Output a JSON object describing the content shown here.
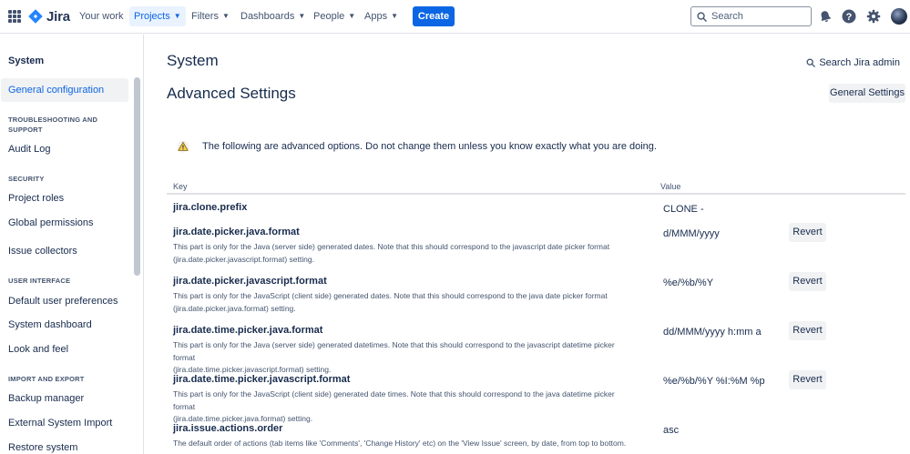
{
  "brand": {
    "name": "Jira"
  },
  "nav": {
    "your_work": "Your work",
    "projects": "Projects",
    "filters": "Filters",
    "dashboards": "Dashboards",
    "people": "People",
    "apps": "Apps",
    "create": "Create"
  },
  "search": {
    "placeholder": "Search"
  },
  "icons": {
    "apps": "app-switcher-icon",
    "notifications": "bell-icon",
    "help": "help-icon",
    "settings": "gear-icon",
    "search": "search-icon",
    "warning": "warning-icon"
  },
  "colors": {
    "accent": "#0c66e4",
    "warning": "#f5cd47",
    "selected_bg": "#e9f2ff"
  },
  "sidebar": {
    "title": "System",
    "general_configuration": "General configuration",
    "troubleshooting_heading": "TROUBLESHOOTING AND SUPPORT",
    "audit_log": "Audit Log",
    "security_heading": "SECURITY",
    "project_roles": "Project roles",
    "global_permissions": "Global permissions",
    "issue_collectors": "Issue collectors",
    "user_interface_heading": "USER INTERFACE",
    "default_user_preferences": "Default user preferences",
    "system_dashboard": "System dashboard",
    "look_and_feel": "Look and feel",
    "import_export_heading": "IMPORT AND EXPORT",
    "backup_manager": "Backup manager",
    "external_system_import": "External System Import",
    "restore_system": "Restore system"
  },
  "main": {
    "page_title": "System",
    "admin_search": "Search Jira admin",
    "section_title": "Advanced Settings",
    "general_settings_button": "General Settings",
    "warning": "The following are advanced options. Do not change them unless you know exactly what you are doing.",
    "columns": {
      "key": "Key",
      "value": "Value"
    },
    "revert_label": "Revert",
    "rows": [
      {
        "key": "jira.clone.prefix",
        "desc1": "",
        "desc2": "",
        "value": "CLONE -"
      },
      {
        "key": "jira.date.picker.java.format",
        "desc1": "This part is only for the Java (server side) generated dates. Note that this should correspond to the javascript date picker format",
        "desc2": "(jira.date.picker.javascript.format) setting.",
        "value": "d/MMM/yyyy"
      },
      {
        "key": "jira.date.picker.javascript.format",
        "desc1": "This part is only for the JavaScript (client side) generated dates. Note that this should correspond to the java date picker format",
        "desc2": "(jira.date.picker.java.format) setting.",
        "value": "%e/%b/%Y"
      },
      {
        "key": "jira.date.time.picker.java.format",
        "desc1": "This part is only for the Java (server side) generated datetimes. Note that this should correspond to the javascript datetime picker format",
        "desc2": "(jira.date.time.picker.javascript.format) setting.",
        "value": "dd/MMM/yyyy h:mm a"
      },
      {
        "key": "jira.date.time.picker.javascript.format",
        "desc1": "This part is only for the JavaScript (client side) generated date times. Note that this should correspond to the java datetime picker format",
        "desc2": "(jira.date.time.picker.java.format) setting.",
        "value": "%e/%b/%Y %I:%M %p"
      },
      {
        "key": "jira.issue.actions.order",
        "desc1": "The default order of actions (tab items like 'Comments', 'Change History' etc) on the 'View Issue' screen, by date, from top to bottom.",
        "desc2": "",
        "value": "asc"
      }
    ]
  }
}
